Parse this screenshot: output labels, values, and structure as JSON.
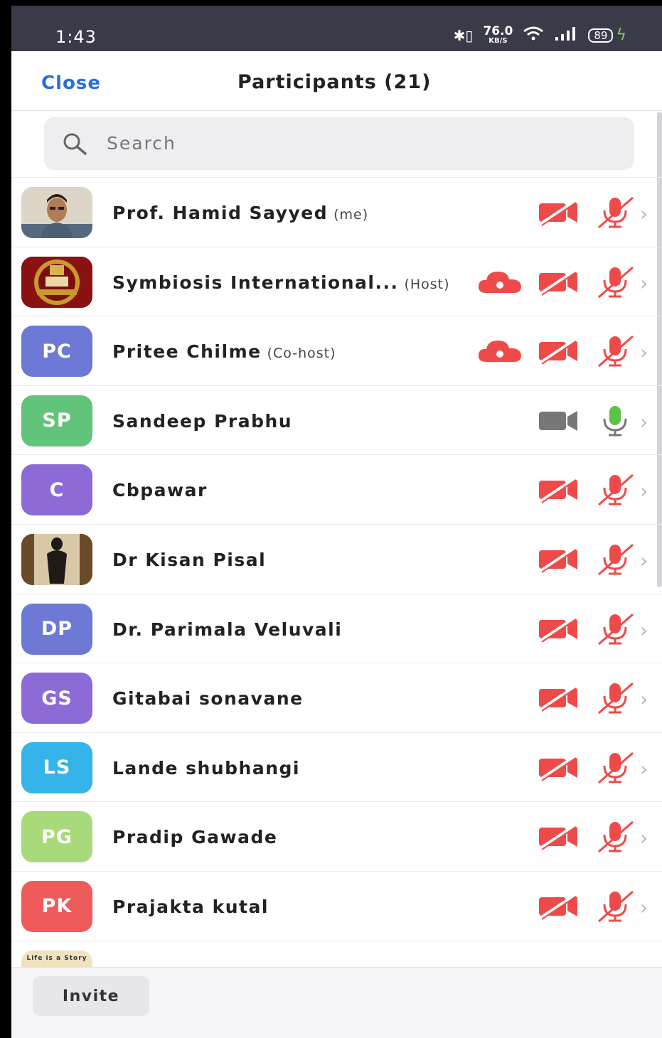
{
  "status_bar": {
    "time": "1:43",
    "speed_value": "76.0",
    "speed_unit": "KB/S",
    "battery": "89"
  },
  "header": {
    "close_label": "Close",
    "title": "Participants (21)"
  },
  "search": {
    "placeholder": "Search"
  },
  "colors": {
    "accent_blue": "#2a6fd9",
    "muted_red": "#ef4a4a",
    "unmuted_green": "#5cc242",
    "camera_on_gray": "#777777"
  },
  "participants": [
    {
      "name": "Prof. Hamid Sayyed",
      "role": "(me)",
      "avatar_type": "photo-person",
      "initials": "",
      "avatar_color": "#c9c2b5",
      "recording": false,
      "video": "off",
      "mic": "muted"
    },
    {
      "name": "Symbiosis International...",
      "role": "(Host)",
      "avatar_type": "photo-logo",
      "initials": "",
      "avatar_color": "#7a1010",
      "recording": true,
      "video": "off",
      "mic": "muted"
    },
    {
      "name": "Pritee Chilme",
      "role": "(Co-host)",
      "avatar_type": "initials",
      "initials": "PC",
      "avatar_color": "#6e79d6",
      "recording": true,
      "video": "off",
      "mic": "muted"
    },
    {
      "name": "Sandeep Prabhu",
      "role": "",
      "avatar_type": "initials",
      "initials": "SP",
      "avatar_color": "#62c37a",
      "recording": false,
      "video": "on",
      "mic": "on"
    },
    {
      "name": "Cbpawar",
      "role": "",
      "avatar_type": "initials",
      "initials": "C",
      "avatar_color": "#8d6bd6",
      "recording": false,
      "video": "off",
      "mic": "muted"
    },
    {
      "name": "Dr Kisan Pisal",
      "role": "",
      "avatar_type": "photo-statue",
      "initials": "",
      "avatar_color": "#3b3228",
      "recording": false,
      "video": "off",
      "mic": "muted"
    },
    {
      "name": "Dr. Parimala Veluvali",
      "role": "",
      "avatar_type": "initials",
      "initials": "DP",
      "avatar_color": "#6e79d6",
      "recording": false,
      "video": "off",
      "mic": "muted"
    },
    {
      "name": "Gitabai sonavane",
      "role": "",
      "avatar_type": "initials",
      "initials": "GS",
      "avatar_color": "#8d6bd6",
      "recording": false,
      "video": "off",
      "mic": "muted"
    },
    {
      "name": "Lande shubhangi",
      "role": "",
      "avatar_type": "initials",
      "initials": "LS",
      "avatar_color": "#35b4ea",
      "recording": false,
      "video": "off",
      "mic": "muted"
    },
    {
      "name": "Pradip Gawade",
      "role": "",
      "avatar_type": "initials",
      "initials": "PG",
      "avatar_color": "#a8d97a",
      "recording": false,
      "video": "off",
      "mic": "muted"
    },
    {
      "name": "Prajakta kutal",
      "role": "",
      "avatar_type": "initials",
      "initials": "PK",
      "avatar_color": "#ef5a5a",
      "recording": false,
      "video": "off",
      "mic": "muted"
    }
  ],
  "partial_row": {
    "avatar_text": "Life is a Story"
  },
  "bottom_bar": {
    "invite_label": "Invite"
  }
}
